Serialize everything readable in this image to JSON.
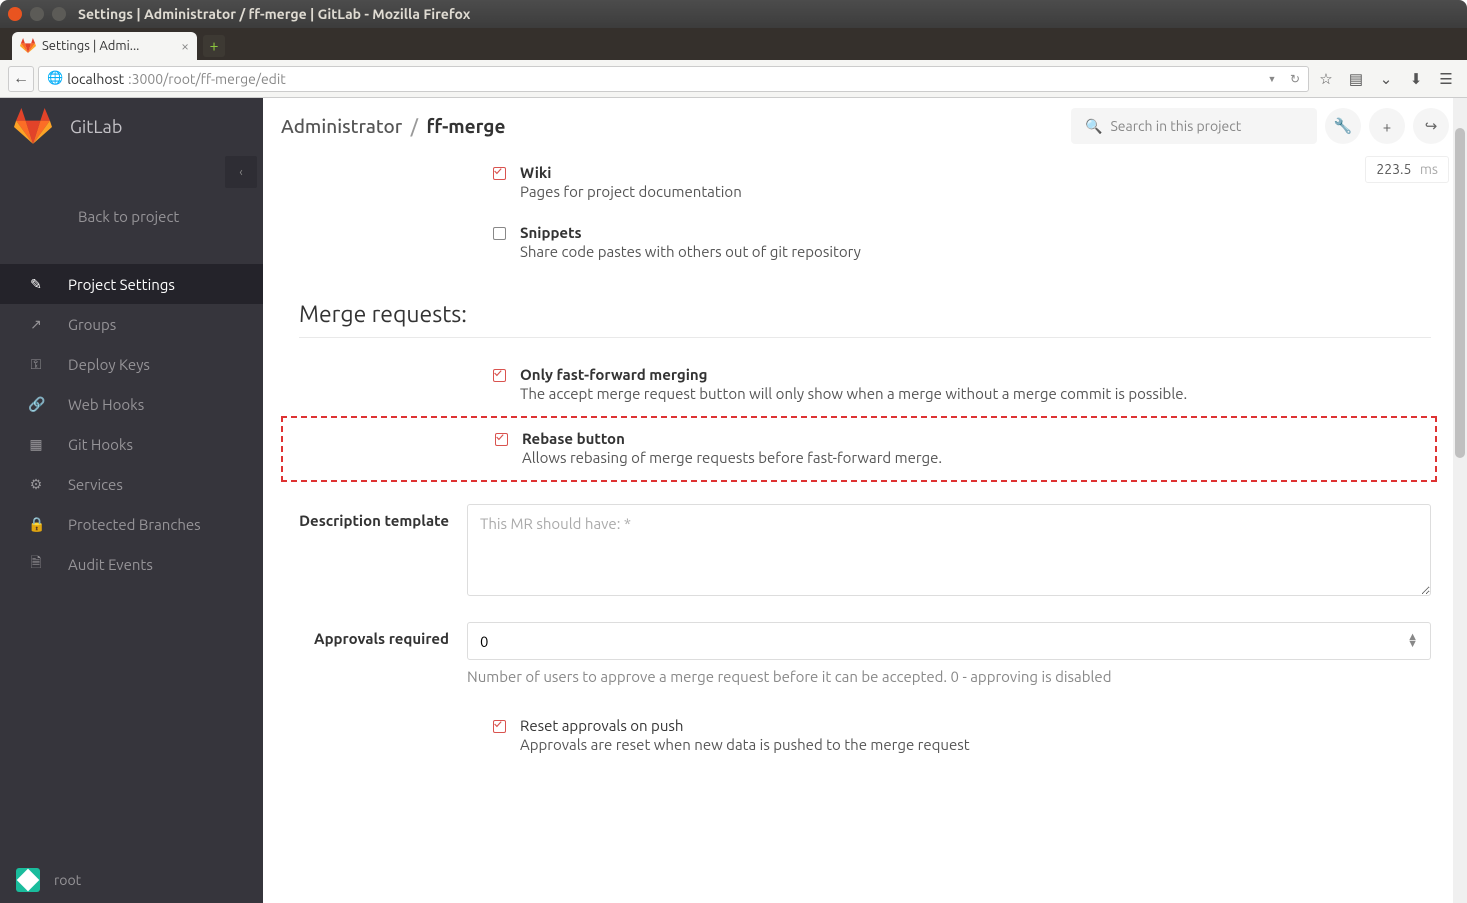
{
  "window": {
    "title": "Settings | Administrator / ff-merge | GitLab - Mozilla Firefox"
  },
  "tab": {
    "title": "Settings | Admi..."
  },
  "url": {
    "host": "localhost",
    "port_path": ":3000/root/ff-merge/edit"
  },
  "sidebar": {
    "brand": "GitLab",
    "back": "Back to project",
    "items": [
      {
        "icon": "edit-icon",
        "label": "Project Settings",
        "active": true
      },
      {
        "icon": "share-icon",
        "label": "Groups",
        "active": false
      },
      {
        "icon": "key-icon",
        "label": "Deploy Keys",
        "active": false
      },
      {
        "icon": "link-icon",
        "label": "Web Hooks",
        "active": false
      },
      {
        "icon": "git-icon",
        "label": "Git Hooks",
        "active": false
      },
      {
        "icon": "cogs-icon",
        "label": "Services",
        "active": false
      },
      {
        "icon": "lock-icon",
        "label": "Protected Branches",
        "active": false
      },
      {
        "icon": "file-icon",
        "label": "Audit Events",
        "active": false
      }
    ],
    "user": "root"
  },
  "header": {
    "breadcrumb_owner": "Administrator",
    "breadcrumb_project": "ff-merge",
    "search_placeholder": "Search in this project",
    "timing_value": "223.5",
    "timing_unit": "ms"
  },
  "features": {
    "wiki": {
      "title": "Wiki",
      "desc": "Pages for project documentation",
      "checked": true
    },
    "snippets": {
      "title": "Snippets",
      "desc": "Share code pastes with others out of git repository",
      "checked": false
    }
  },
  "merge_section": {
    "title": "Merge requests:",
    "ff": {
      "title": "Only fast-forward merging",
      "desc": "The accept merge request button will only show when a merge without a merge commit is possible.",
      "checked": true
    },
    "rebase": {
      "title": "Rebase button",
      "desc": "Allows rebasing of merge requests before fast-forward merge.",
      "checked": true
    },
    "desc_template": {
      "label": "Description template",
      "placeholder": "This MR should have: *"
    },
    "approvals": {
      "label": "Approvals required",
      "value": "0",
      "help": "Number of users to approve a merge request before it can be accepted. 0 - approving is disabled"
    },
    "reset": {
      "title": "Reset approvals on push",
      "desc": "Approvals are reset when new data is pushed to the merge request",
      "checked": true
    }
  }
}
